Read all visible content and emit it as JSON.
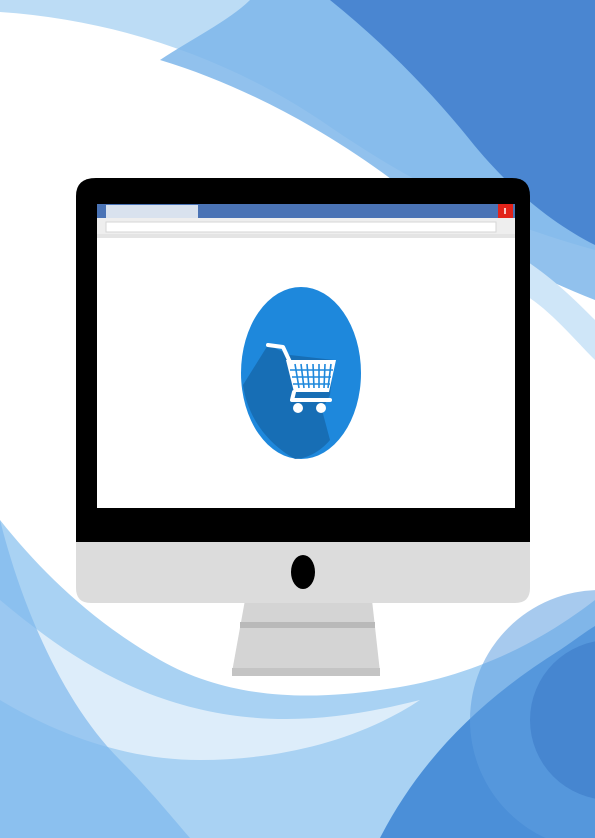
{
  "illustration": {
    "subject": "desktop-monitor-with-shopping-cart",
    "colors": {
      "background_wave_light": "#cfe6f8",
      "background_wave_mid": "#8fc3ee",
      "background_wave_deep": "#3e7ecf",
      "monitor_bezel": "#000000",
      "monitor_chin": "#dcdcdc",
      "monitor_stand": "#d2d2d2",
      "browser_titlebar": "#4a73b5",
      "browser_tab": "#d9e2ee",
      "browser_close": "#e2231a",
      "browser_addressbar": "#f2f2f2",
      "screen_content": "#ffffff",
      "cart_circle": "#1e88dc",
      "cart_shadow": "#1665a8",
      "cart_icon": "#ffffff"
    },
    "icons": {
      "camera_logo": "camera-icon",
      "cart": "shopping-cart-icon",
      "close": "close-icon"
    }
  }
}
